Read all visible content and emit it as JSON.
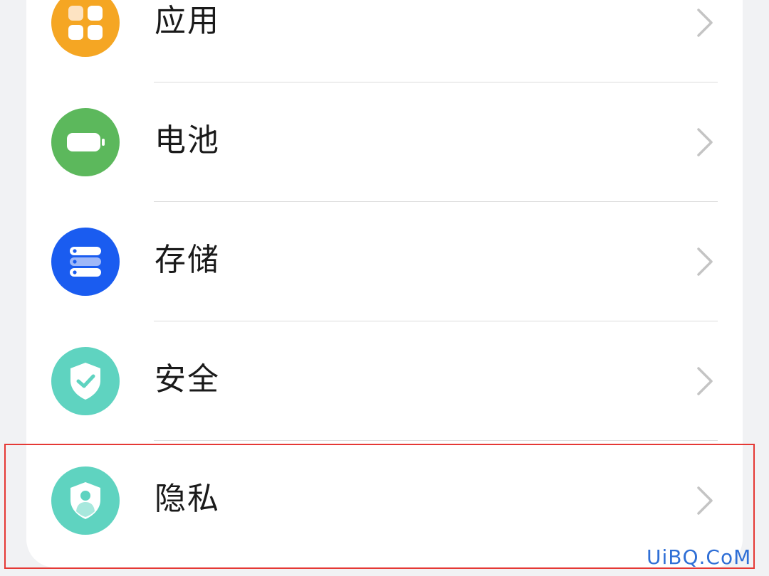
{
  "settings": {
    "items": [
      {
        "label": "应用",
        "icon": "apps-icon",
        "color": "#f5a623"
      },
      {
        "label": "电池",
        "icon": "battery-icon",
        "color": "#5cb85c"
      },
      {
        "label": "存储",
        "icon": "storage-icon",
        "color": "#1a5cf0"
      },
      {
        "label": "安全",
        "icon": "security-shield-icon",
        "color": "#5fd3c0"
      },
      {
        "label": "隐私",
        "icon": "privacy-shield-icon",
        "color": "#5fd3c0"
      }
    ],
    "highlighted_item": "隐私"
  },
  "watermark": "UiBQ.CoM",
  "colors": {
    "highlight_border": "#e53935",
    "watermark": "#2f6fd6"
  }
}
